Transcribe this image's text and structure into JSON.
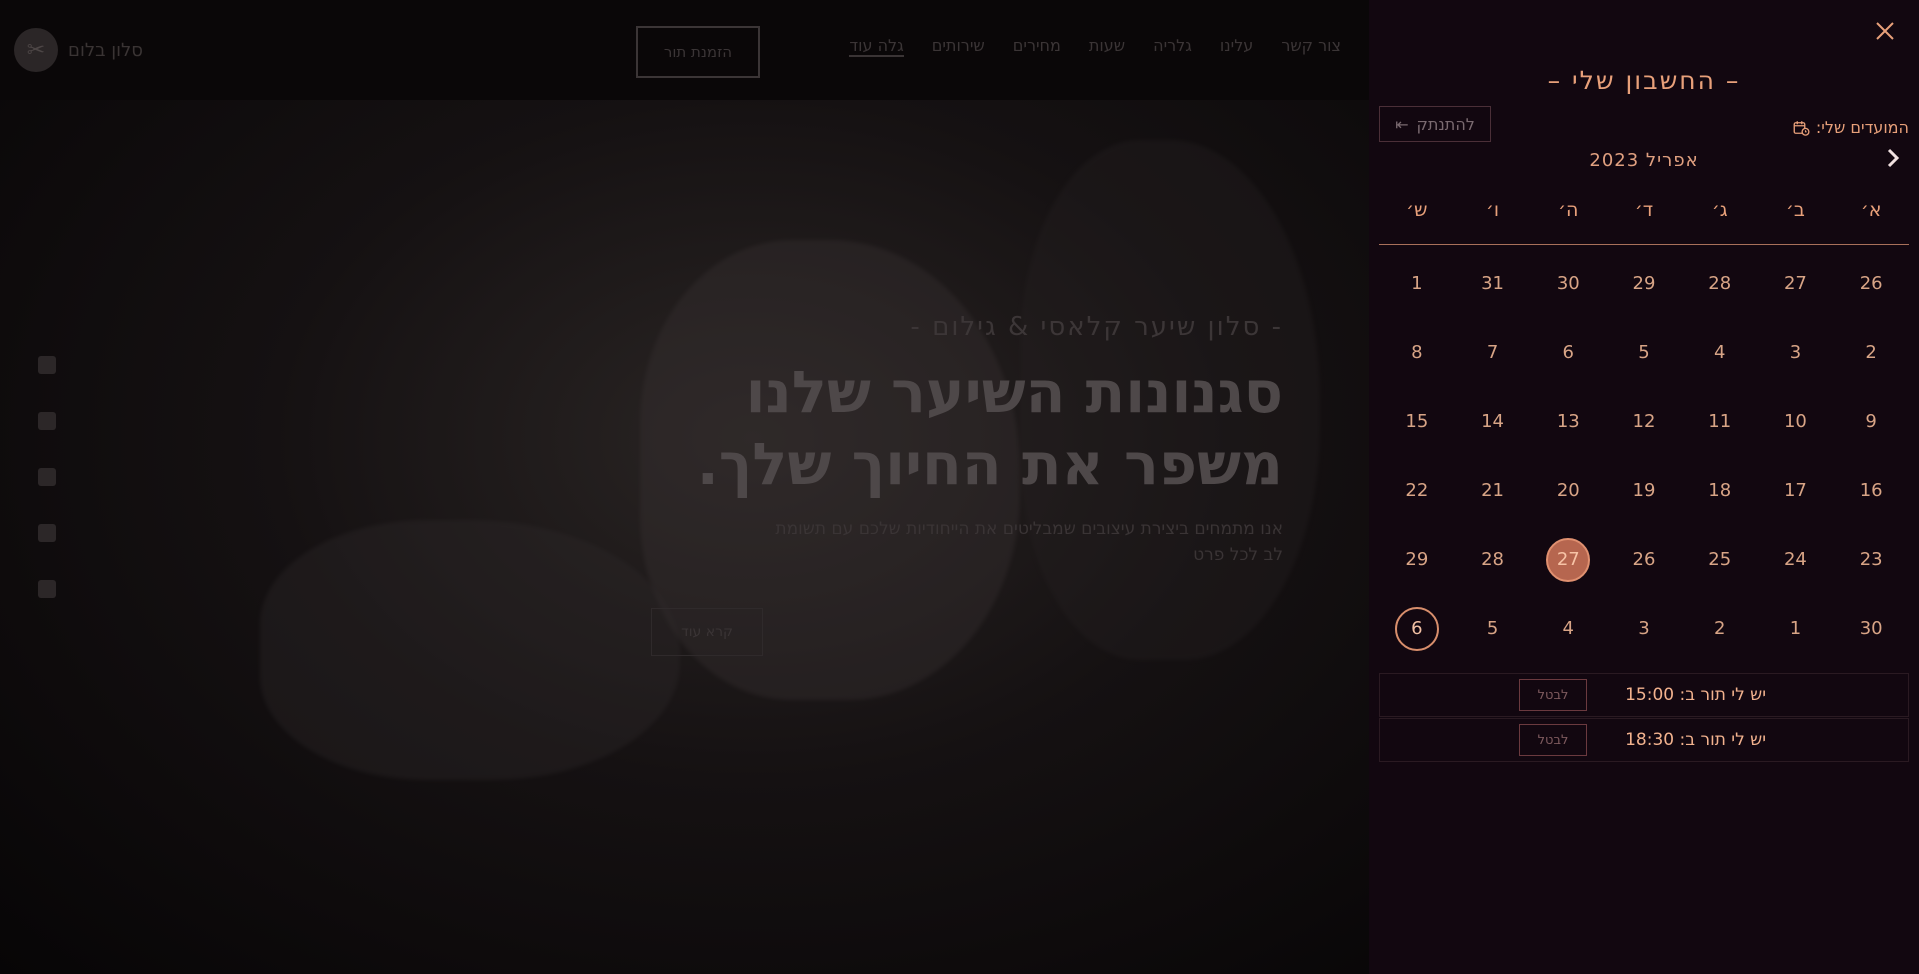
{
  "colors": {
    "accent": "#e8a07a",
    "panel_bg": "#120710",
    "today_fill": "#b6664f"
  },
  "background_page": {
    "logo_text": "סלון בלום",
    "nav_items": [
      "גלה עוד",
      "שירותים",
      "מחירים",
      "שעות",
      "גלריה",
      "עלינו",
      "צור קשר"
    ],
    "cta_label": "הזמנת תור",
    "hero_subtitle": "- סלון שיער קלאסי & גילום -",
    "hero_title_line1": "סגנונות השיער שלנו",
    "hero_title_line2": "משפר את החיוך שלך.",
    "hero_desc": "אנו מתמחים ביצירת עיצובים שמבליטים את הייחודיות שלכם עם תשומת לב לכל פרט",
    "hero_button": "קרא עוד"
  },
  "panel": {
    "title": "– החשבון שלי –",
    "logout_label": "להתנתק",
    "appointments_label": "המועדים שלי:",
    "month_label": "אפריל 2023",
    "weekdays": [
      "א׳",
      "ב׳",
      "ג׳",
      "ד׳",
      "ה׳",
      "ו׳",
      "ש׳"
    ],
    "weeks": [
      [
        "26",
        "27",
        "28",
        "29",
        "30",
        "31",
        "1"
      ],
      [
        "2",
        "3",
        "4",
        "5",
        "6",
        "7",
        "8"
      ],
      [
        "9",
        "10",
        "11",
        "12",
        "13",
        "14",
        "15"
      ],
      [
        "16",
        "17",
        "18",
        "19",
        "20",
        "21",
        "22"
      ],
      [
        "23",
        "24",
        "25",
        "26",
        "27",
        "28",
        "29"
      ],
      [
        "30",
        "1",
        "2",
        "3",
        "4",
        "5",
        "6"
      ]
    ],
    "today": "27",
    "selected": "6",
    "appointments": [
      {
        "text": "יש לי תור ב: 15:00",
        "cancel": "לבטל"
      },
      {
        "text": "יש לי תור ב: 18:30",
        "cancel": "לבטל"
      }
    ]
  }
}
